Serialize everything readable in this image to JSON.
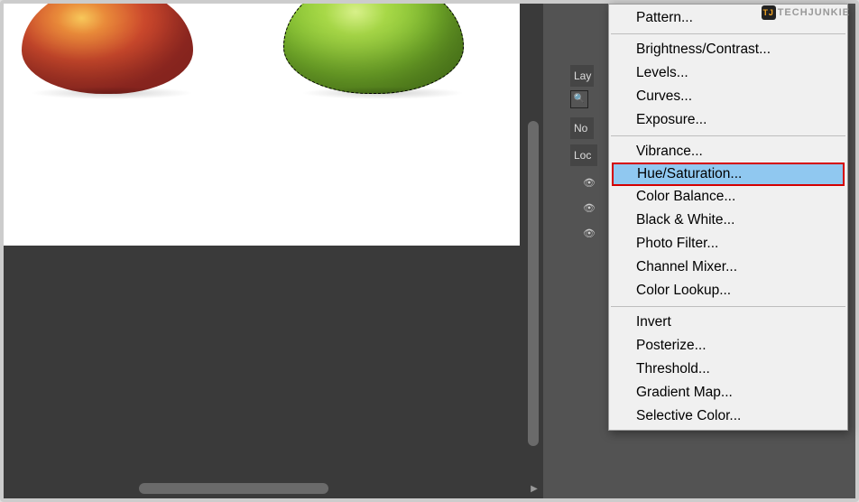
{
  "watermark": {
    "logo": "TJ",
    "text": "TECHJUNKIE"
  },
  "panels": {
    "layers_tab": "Lay",
    "normal_label": "No",
    "lock_label": "Loc"
  },
  "menu": {
    "groups": [
      [
        "Pattern..."
      ],
      [
        "Brightness/Contrast...",
        "Levels...",
        "Curves...",
        "Exposure..."
      ],
      [
        "Vibrance...",
        "Hue/Saturation...",
        "Color Balance...",
        "Black & White...",
        "Photo Filter...",
        "Channel Mixer...",
        "Color Lookup..."
      ],
      [
        "Invert",
        "Posterize...",
        "Threshold...",
        "Gradient Map...",
        "Selective Color..."
      ]
    ],
    "highlighted": "Hue/Saturation..."
  }
}
